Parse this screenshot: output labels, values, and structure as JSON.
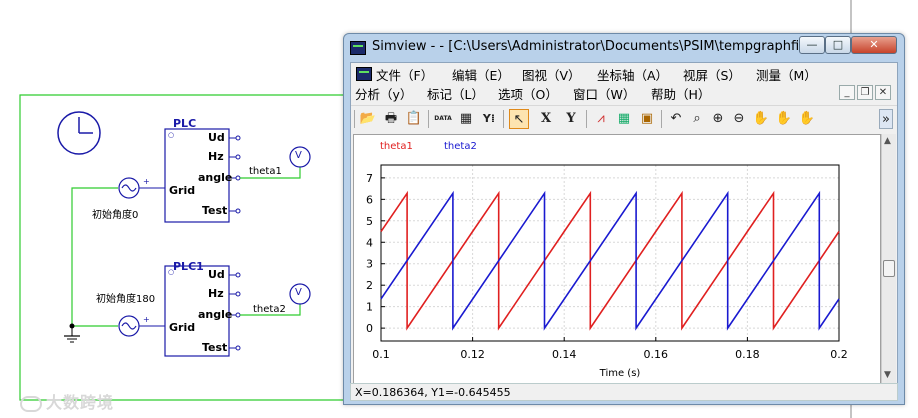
{
  "schematic": {
    "block1": {
      "title": "PLC",
      "ports_out": [
        "Ud",
        "Hz",
        "angle",
        "Test"
      ],
      "port_in": "Grid"
    },
    "block2": {
      "title": "PLC1",
      "ports_out": [
        "Ud",
        "Hz",
        "angle",
        "Test"
      ],
      "port_in": "Grid"
    },
    "source1_label": "初始角度0",
    "source2_label": "初始角度180",
    "wire1_label": "theta1",
    "wire2_label": "theta2",
    "voltmeter_symbol": "V",
    "watermark_text": "大数跨境",
    "wire_color": "#2ecc2e",
    "block_color": "#1a1aa8"
  },
  "window": {
    "title": "Simview -  - [C:\\Users\\Administrator\\Documents\\PSIM\\tempgraphfi...",
    "buttons": {
      "minimize": "—",
      "maximize": "□",
      "close": "✕"
    },
    "menu_row1": [
      "文件（F）",
      "编辑（E）",
      "图视（V）",
      "坐标轴（A）",
      "视屏（S）",
      "测量（M）"
    ],
    "menu_row2": [
      "分析（y）",
      "标记（L）",
      "选项（O）",
      "窗口（W）",
      "帮助（H）"
    ],
    "mdi_buttons": [
      "_",
      "❐",
      "✕"
    ],
    "toolbar": [
      {
        "icon": "open-folder-icon",
        "glyph": "📂"
      },
      {
        "icon": "print-icon",
        "glyph": "🖶"
      },
      {
        "icon": "clipboard-icon",
        "glyph": "📋"
      },
      {
        "icon": "data-icon",
        "glyph": "DATA"
      },
      {
        "icon": "graph-data-icon",
        "glyph": "▦"
      },
      {
        "icon": "y-axis-select-icon",
        "glyph": "Y⁞"
      },
      {
        "icon": "pointer-icon",
        "glyph": "↖"
      },
      {
        "icon": "x-axis-icon",
        "glyph": "X"
      },
      {
        "icon": "y-axis-icon",
        "glyph": "Y"
      },
      {
        "icon": "fft-icon",
        "glyph": "⩘"
      },
      {
        "icon": "grid-layout-icon",
        "glyph": "▦"
      },
      {
        "icon": "screen-layout-icon",
        "glyph": "▣"
      },
      {
        "icon": "undo-icon",
        "glyph": "↶"
      },
      {
        "icon": "zoom-icon",
        "glyph": "⌕"
      },
      {
        "icon": "zoom-in-icon",
        "glyph": "⊕"
      },
      {
        "icon": "zoom-out-icon",
        "glyph": "⊖"
      },
      {
        "icon": "pan-hand-icon",
        "glyph": "✋"
      },
      {
        "icon": "hand-left-icon",
        "glyph": "✋"
      },
      {
        "icon": "hand-right-icon",
        "glyph": "✋"
      },
      {
        "icon": "toolbar-overflow-icon",
        "glyph": "»"
      }
    ],
    "status": "X=0.186364, Y1=-0.645455"
  },
  "chart_data": {
    "type": "line",
    "title": "",
    "xlabel": "Time (s)",
    "ylabel": "",
    "xlim": [
      0.1,
      0.2
    ],
    "ylim": [
      -0.6,
      7.6
    ],
    "xticks": [
      0.1,
      0.12,
      0.14,
      0.16,
      0.18,
      0.2
    ],
    "xtick_labels": [
      "0.1",
      "0.12",
      "0.14",
      "0.16",
      "0.18",
      "0.2"
    ],
    "yticks": [
      0,
      1,
      2,
      3,
      4,
      5,
      6,
      7
    ],
    "grid": true,
    "legend_position": "top-left",
    "series": [
      {
        "name": "theta1",
        "color": "#e02020",
        "x": [
          0.1,
          0.1057,
          0.1057,
          0.12,
          0.1257,
          0.1257,
          0.14,
          0.1457,
          0.1457,
          0.16,
          0.1657,
          0.1657,
          0.18,
          0.1857,
          0.1857,
          0.2
        ],
        "y": [
          4.5,
          6.28,
          0,
          4.5,
          6.28,
          0,
          4.5,
          6.28,
          0,
          4.5,
          6.28,
          0,
          4.5,
          6.28,
          0,
          4.5
        ]
      },
      {
        "name": "theta2",
        "color": "#1a1ad0",
        "x": [
          0.1,
          0.1157,
          0.1157,
          0.1357,
          0.1357,
          0.1557,
          0.1557,
          0.1757,
          0.1757,
          0.1957,
          0.1957,
          0.2
        ],
        "y": [
          1.36,
          6.28,
          0,
          6.28,
          0,
          6.28,
          0,
          6.28,
          0,
          6.28,
          0,
          1.36
        ]
      }
    ]
  }
}
